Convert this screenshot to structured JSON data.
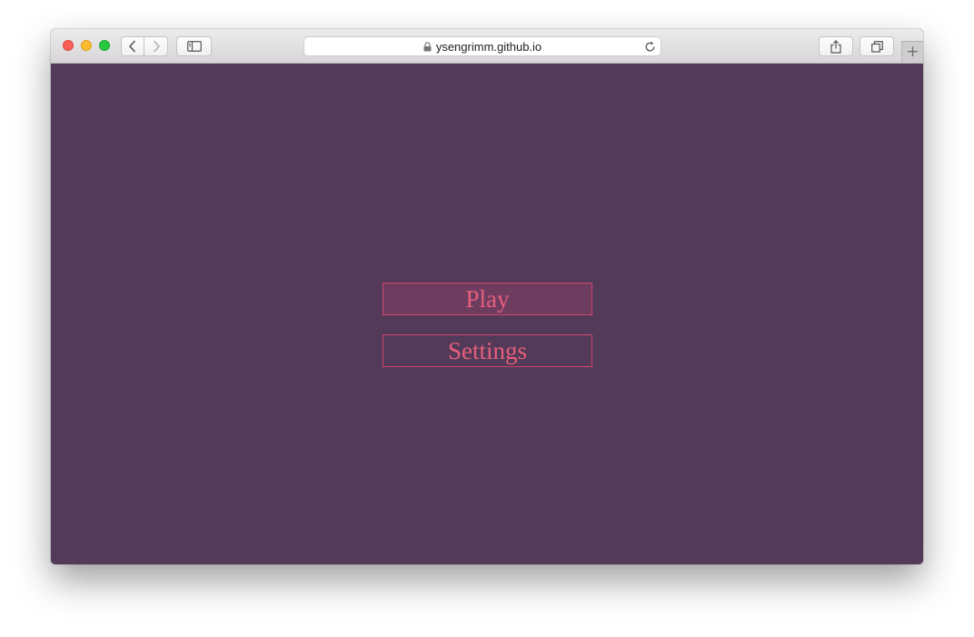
{
  "browser": {
    "url": "ysengrimm.github.io",
    "icons": {
      "back": "chevron-left-icon",
      "forward": "chevron-right-icon",
      "sidebar": "sidebar-icon",
      "lock": "lock-icon",
      "reload": "reload-icon",
      "share": "share-icon",
      "tabs": "tabs-overview-icon",
      "new_tab": "plus-icon"
    },
    "new_tab_glyph": "+"
  },
  "menu": {
    "play_label": "Play",
    "settings_label": "Settings"
  },
  "colors": {
    "background": "#533a58",
    "accent": "#e65f7d",
    "button_border": "#d0476c",
    "play_fill": "#6e3c5f"
  }
}
